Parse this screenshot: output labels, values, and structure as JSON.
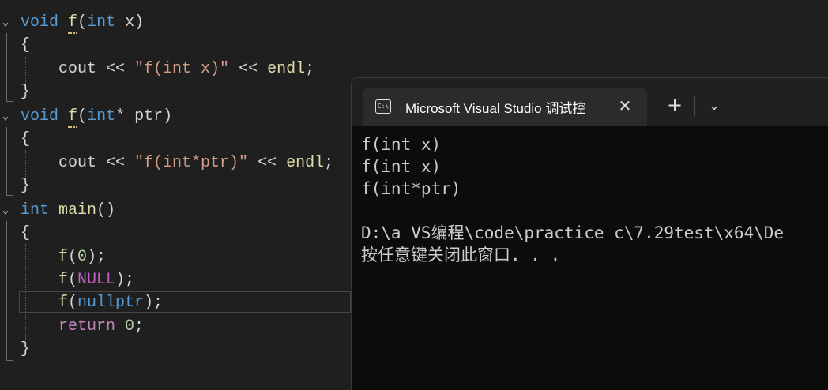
{
  "editor": {
    "fold_icon": "chevron-down-icon",
    "lines": {
      "l1": {
        "kw": "void",
        "fn": "f",
        "open": "(",
        "type": "int",
        "arg": " x",
        "close": ")"
      },
      "l2": {
        "text": "{"
      },
      "l3": {
        "ident": "cout",
        "op1": " << ",
        "str": "\"f(int x)\"",
        "op2": " << ",
        "endl": "endl",
        "semi": ";"
      },
      "l4": {
        "text": "}"
      },
      "l5": {
        "kw": "void",
        "fn": "f",
        "open": "(",
        "type": "int",
        "arg": "* ptr",
        "close": ")"
      },
      "l6": {
        "text": "{"
      },
      "l7": {
        "ident": "cout",
        "op1": " << ",
        "str": "\"f(int*ptr)\"",
        "op2": " << ",
        "endl": "endl",
        "semi": ";"
      },
      "l8": {
        "text": "}"
      },
      "l9": {
        "kw": "int",
        "fn": "main",
        "parens": "()"
      },
      "l10": {
        "text": "{"
      },
      "l11": {
        "fn": "f",
        "open": "(",
        "arg": "0",
        "close": ");"
      },
      "l12": {
        "fn": "f",
        "open": "(",
        "arg": "NULL",
        "close": ");"
      },
      "l13": {
        "fn": "f",
        "open": "(",
        "arg": "nullptr",
        "close": ");"
      },
      "l14": {
        "kw": "return",
        "arg": " 0",
        "semi": ";"
      },
      "l15": {
        "text": "}"
      }
    }
  },
  "terminal": {
    "tab_title": "Microsoft Visual Studio 调试控",
    "tab_icon": "terminal-icon",
    "close_glyph": "✕",
    "new_tab_glyph": "+",
    "dropdown_glyph": "⌄",
    "output": [
      "f(int x)",
      "f(int x)",
      "f(int*ptr)",
      "",
      "D:\\a VS编程\\code\\practice_c\\7.29test\\x64\\De",
      "按任意键关闭此窗口. . ."
    ]
  },
  "colors": {
    "keyword": "#569cd6",
    "function": "#dcdcaa",
    "string": "#d69d85",
    "number": "#b5cea8",
    "control": "#c586c0",
    "macro": "#bd63c5",
    "editor_bg": "#1f1f1f",
    "terminal_bg": "#0c0c0c"
  }
}
